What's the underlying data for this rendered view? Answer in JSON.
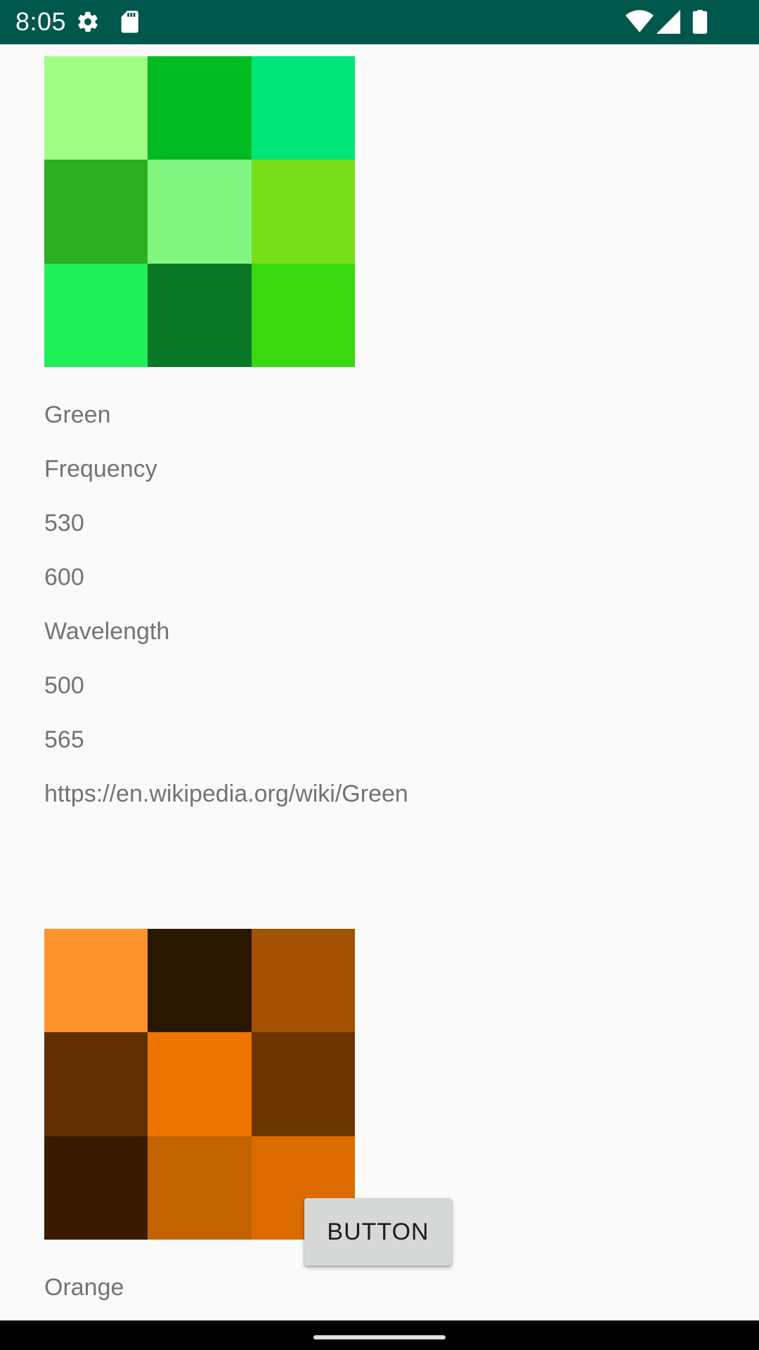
{
  "status_bar": {
    "time": "8:05",
    "icons": [
      "gear-icon",
      "sd-card-icon",
      "wifi-icon",
      "signal-icon",
      "battery-icon"
    ],
    "background": "#00574b"
  },
  "entries": [
    {
      "name": "Green",
      "swatches": [
        "#a2ff86",
        "#00bb22",
        "#00e578",
        "#2daf22",
        "#80f580",
        "#78df18",
        "#1ff05a",
        "#0b7828",
        "#38d910"
      ],
      "frequency_label": "Frequency",
      "frequency_min": "530",
      "frequency_max": "600",
      "wavelength_label": "Wavelength",
      "wavelength_min": "500",
      "wavelength_max": "565",
      "link": "https://en.wikipedia.org/wiki/Green"
    },
    {
      "name": "Orange",
      "swatches": [
        "#ff942c",
        "#2a1700",
        "#a35200",
        "#612e00",
        "#ed7500",
        "#6c3600",
        "#391b00",
        "#c26200",
        "#dc6b00"
      ]
    }
  ],
  "button": {
    "label": "BUTTON"
  }
}
